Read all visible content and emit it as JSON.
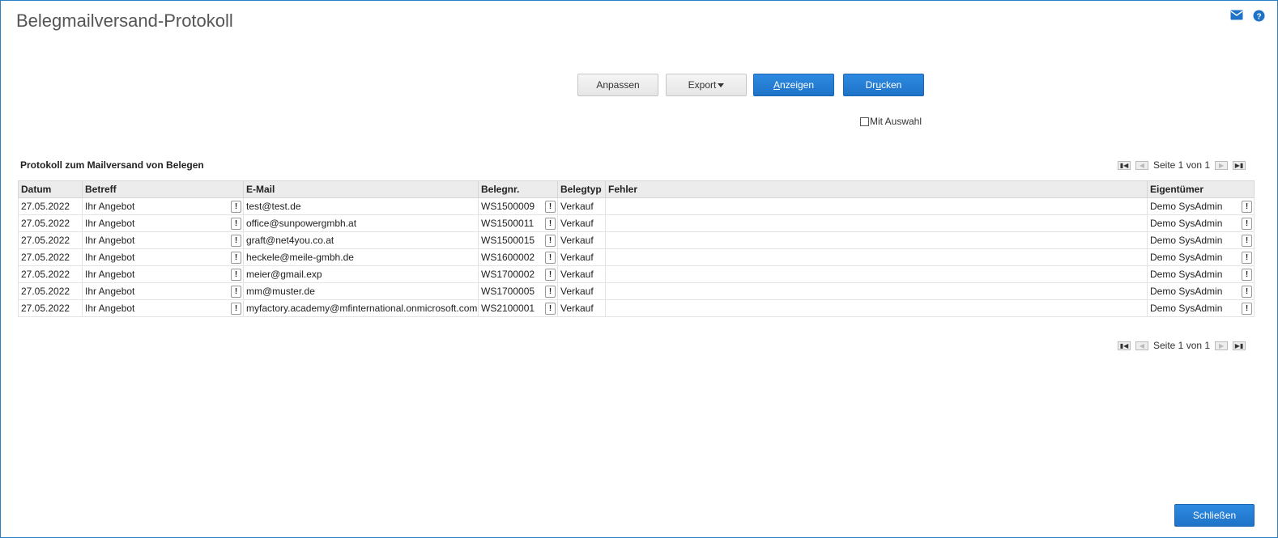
{
  "header": {
    "title": "Belegmailversand-Protokoll",
    "icons": [
      "mail-icon",
      "help-icon"
    ]
  },
  "toolbar": {
    "anpassen": "Anpassen",
    "export": "Export",
    "anzeigen_first": "A",
    "anzeigen_rest": "nzeigen",
    "drucken_pre": "Dr",
    "drucken_u": "u",
    "drucken_post": "cken",
    "mit_auswahl": "Mit Auswahl"
  },
  "grid": {
    "title": "Protokoll zum Mailversand von Belegen",
    "pager_text": "Seite 1 von 1",
    "columns": [
      "Datum",
      "Betreff",
      "E-Mail",
      "Belegnr.",
      "Belegtyp",
      "Fehler",
      "Eigentümer"
    ],
    "rows": [
      [
        "27.05.2022",
        "Ihr Angebot",
        "test@test.de",
        "WS1500009",
        "Verkauf",
        "",
        "Demo SysAdmin"
      ],
      [
        "27.05.2022",
        "Ihr Angebot",
        "office@sunpowergmbh.at",
        "WS1500011",
        "Verkauf",
        "",
        "Demo SysAdmin"
      ],
      [
        "27.05.2022",
        "Ihr Angebot",
        "graft@net4you.co.at",
        "WS1500015",
        "Verkauf",
        "",
        "Demo SysAdmin"
      ],
      [
        "27.05.2022",
        "Ihr Angebot",
        "heckele@meile-gmbh.de",
        "WS1600002",
        "Verkauf",
        "",
        "Demo SysAdmin"
      ],
      [
        "27.05.2022",
        "Ihr Angebot",
        "meier@gmail.exp",
        "WS1700002",
        "Verkauf",
        "",
        "Demo SysAdmin"
      ],
      [
        "27.05.2022",
        "Ihr Angebot",
        "mm@muster.de",
        "WS1700005",
        "Verkauf",
        "",
        "Demo SysAdmin"
      ],
      [
        "27.05.2022",
        "Ihr Angebot",
        "myfactory.academy@mfinternational.onmicrosoft.com",
        "WS2100001",
        "Verkauf",
        "",
        "Demo SysAdmin"
      ]
    ],
    "detail_button": "!"
  },
  "footer": {
    "close": "Schließen"
  },
  "colors": {
    "accent": "#1e73c8",
    "frame": "#2a7fc4"
  }
}
